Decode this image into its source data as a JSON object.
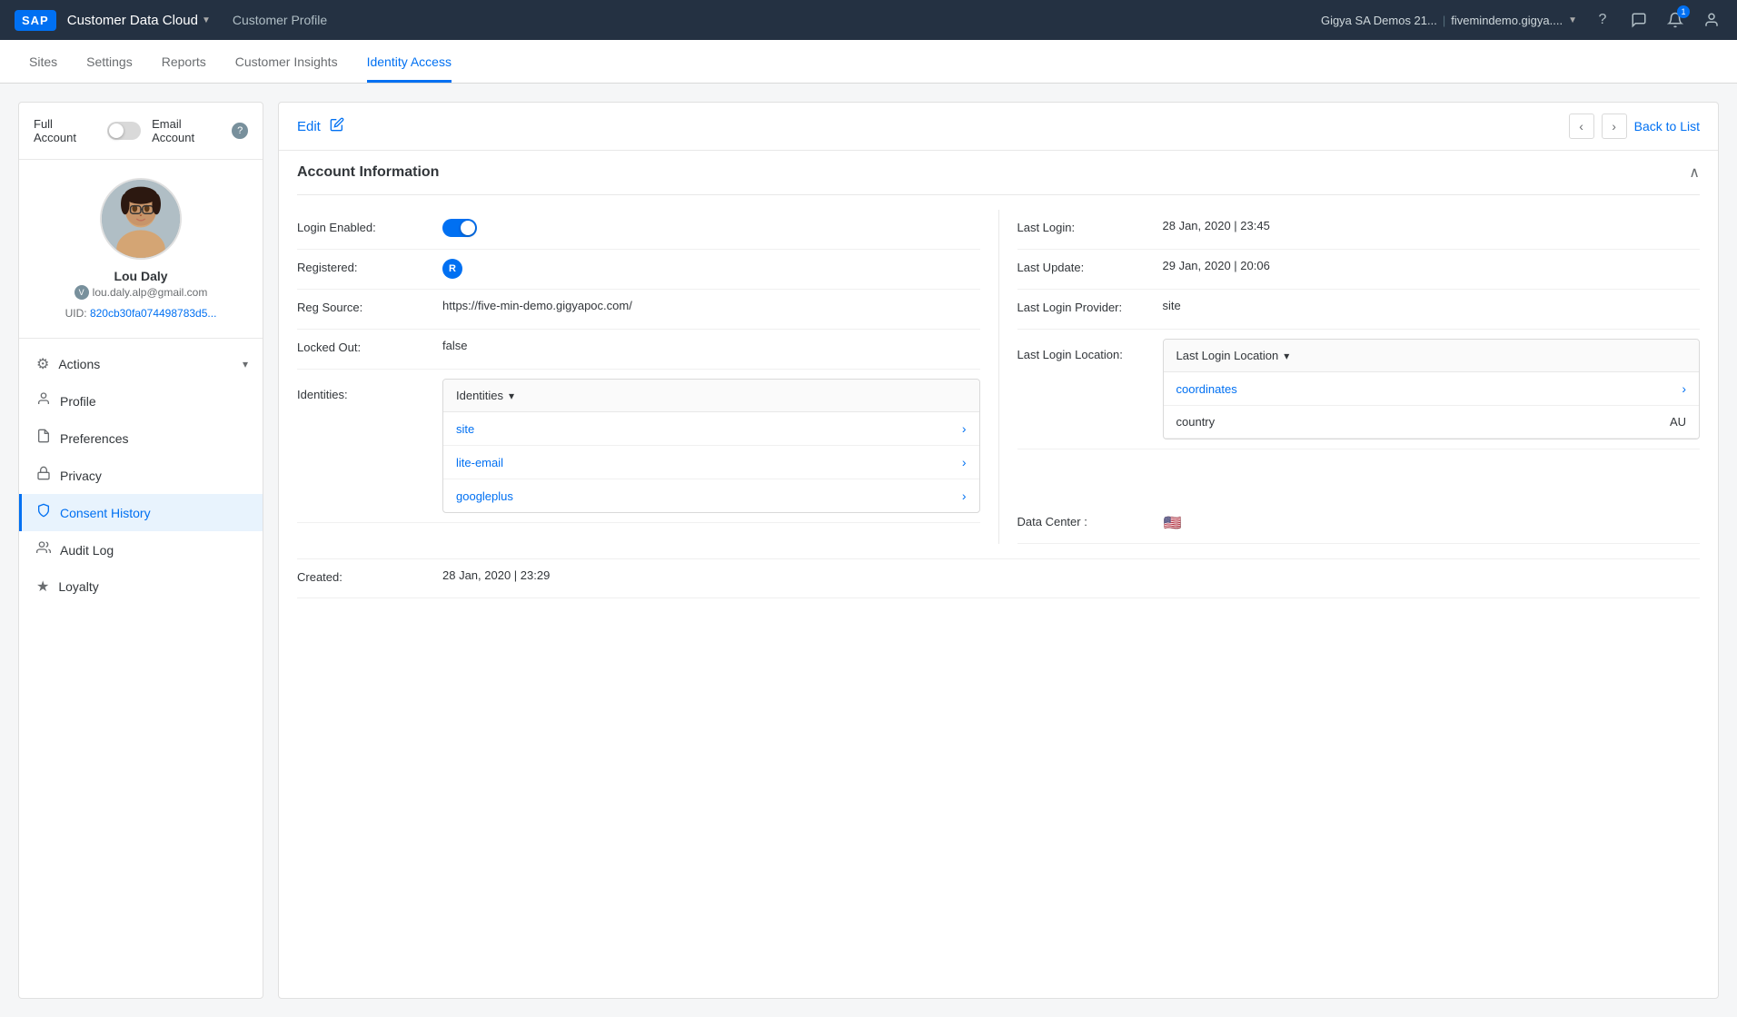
{
  "topNav": {
    "sap_logo": "SAP",
    "product_name": "Customer Data Cloud",
    "page_title": "Customer Profile",
    "account": "Gigya SA Demos 21...",
    "account_url": "fivemindemo.gigya....",
    "icons": {
      "help": "?",
      "chat": "💬",
      "bell": "🔔",
      "bell_badge": "1",
      "user": "👤"
    }
  },
  "tabs": [
    {
      "id": "sites",
      "label": "Sites",
      "active": false
    },
    {
      "id": "settings",
      "label": "Settings",
      "active": false
    },
    {
      "id": "reports",
      "label": "Reports",
      "active": false
    },
    {
      "id": "customer-insights",
      "label": "Customer Insights",
      "active": false
    },
    {
      "id": "identity-access",
      "label": "Identity Access",
      "active": true
    }
  ],
  "sidebar": {
    "full_account_label": "Full Account",
    "email_account_label": "Email Account",
    "help_tooltip": "?",
    "user": {
      "name": "Lou Daly",
      "email": "lou.daly.alp@gmail.com",
      "uid_label": "UID:",
      "uid_value": "820cb30fa074498783d5..."
    },
    "nav_items": [
      {
        "id": "actions",
        "label": "Actions",
        "icon": "⚙",
        "expandable": true,
        "active": false
      },
      {
        "id": "profile",
        "label": "Profile",
        "icon": "👤",
        "expandable": false,
        "active": false
      },
      {
        "id": "preferences",
        "label": "Preferences",
        "icon": "📋",
        "expandable": false,
        "active": false
      },
      {
        "id": "privacy",
        "label": "Privacy",
        "icon": "🔒",
        "expandable": false,
        "active": false
      },
      {
        "id": "consent-history",
        "label": "Consent History",
        "icon": "🛡",
        "expandable": false,
        "active": true
      },
      {
        "id": "audit-log",
        "label": "Audit Log",
        "icon": "👥",
        "expandable": false,
        "active": false
      },
      {
        "id": "loyalty",
        "label": "Loyalty",
        "icon": "★",
        "expandable": false,
        "active": false
      }
    ]
  },
  "content": {
    "edit_label": "Edit",
    "back_to_list_label": "Back to List",
    "section_title": "Account Information",
    "fields_left": [
      {
        "id": "login-enabled",
        "label": "Login Enabled:",
        "type": "toggle_on",
        "value": ""
      },
      {
        "id": "registered",
        "label": "Registered:",
        "type": "badge_r",
        "value": ""
      },
      {
        "id": "reg-source",
        "label": "Reg Source:",
        "type": "text",
        "value": "https://five-min-demo.gigyapoc.com/"
      },
      {
        "id": "locked-out",
        "label": "Locked Out:",
        "type": "text",
        "value": "false"
      },
      {
        "id": "identities",
        "label": "Identities:",
        "type": "identities",
        "value": ""
      }
    ],
    "fields_right": [
      {
        "id": "last-login",
        "label": "Last Login:",
        "value": "28 Jan, 2020 | 23:45"
      },
      {
        "id": "last-update",
        "label": "Last Update:",
        "value": "29 Jan, 2020 | 20:06"
      },
      {
        "id": "last-login-provider",
        "label": "Last Login Provider:",
        "value": "site"
      },
      {
        "id": "last-login-location",
        "label": "Last Login Location:",
        "type": "location_box",
        "value": ""
      }
    ],
    "identities_header": "Identities",
    "identity_items": [
      {
        "id": "site",
        "label": "site"
      },
      {
        "id": "lite-email",
        "label": "lite-email"
      },
      {
        "id": "googleplus",
        "label": "googleplus"
      }
    ],
    "location_header": "Last Login Location",
    "location_items": [
      {
        "id": "coordinates",
        "label": "coordinates",
        "type": "link"
      },
      {
        "id": "country",
        "label": "country",
        "value": "AU",
        "type": "text"
      }
    ],
    "data_center_label": "Data Center :",
    "data_center_flag": "🇺🇸",
    "created_label": "Created:",
    "created_value": "28 Jan, 2020 | 23:29"
  }
}
